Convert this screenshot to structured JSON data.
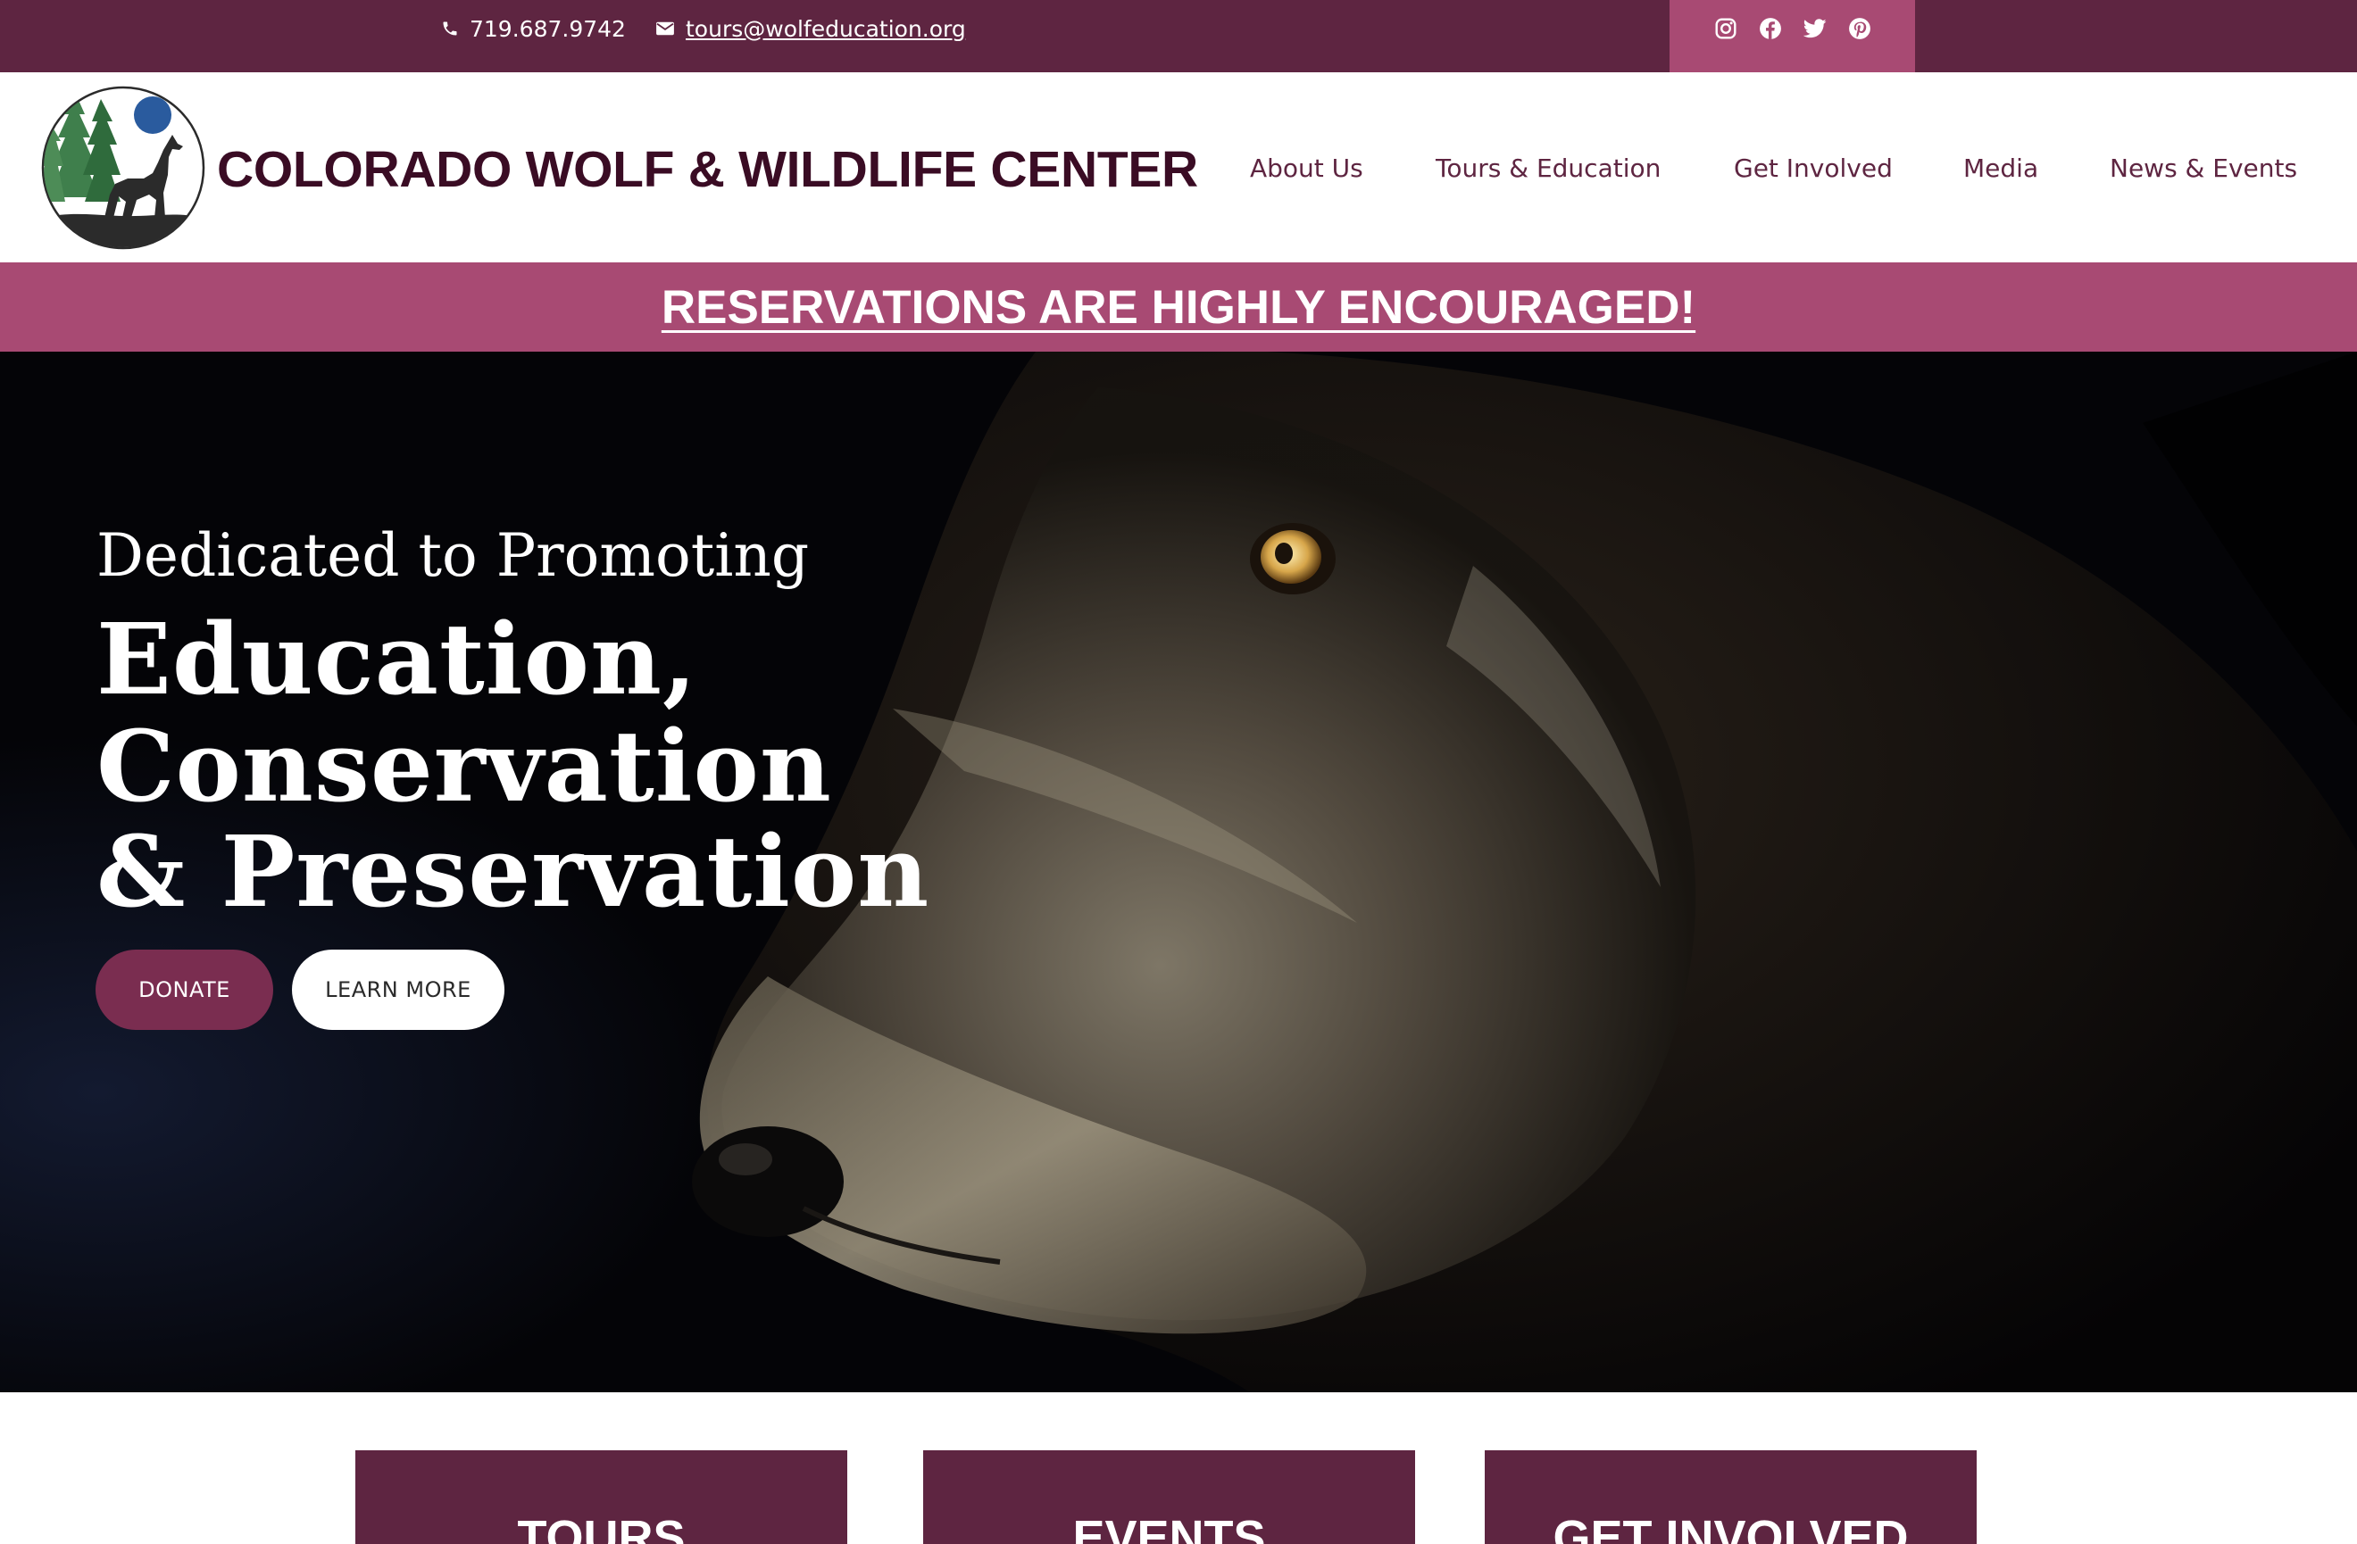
{
  "topbar": {
    "phone": "719.687.9742",
    "email": "tours@wolfeducation.org",
    "icons": [
      "phone-icon",
      "email-icon"
    ],
    "social": [
      "instagram-icon",
      "facebook-icon",
      "twitter-icon",
      "pinterest-icon"
    ]
  },
  "header": {
    "site_title": "COLORADO WOLF & WILDLIFE CENTER",
    "nav": [
      "About Us",
      "Tours & Education",
      "Get Involved",
      "Media",
      "News & Events"
    ]
  },
  "announcement": {
    "text": "RESERVATIONS ARE HIGHLY ENCOURAGED!"
  },
  "hero": {
    "subtitle": "Dedicated to Promoting",
    "lines": [
      "Education,",
      "Conservation",
      "& Preservation"
    ],
    "donate_label": "DONATE",
    "learn_more_label": "LEARN MORE"
  },
  "cards": [
    "TOURS",
    "EVENTS",
    "GET INVOLVED"
  ],
  "colors": {
    "plum": "#5e2541",
    "rose": "#a84a73",
    "donate": "#7a2d50",
    "title": "#3a0c24"
  }
}
